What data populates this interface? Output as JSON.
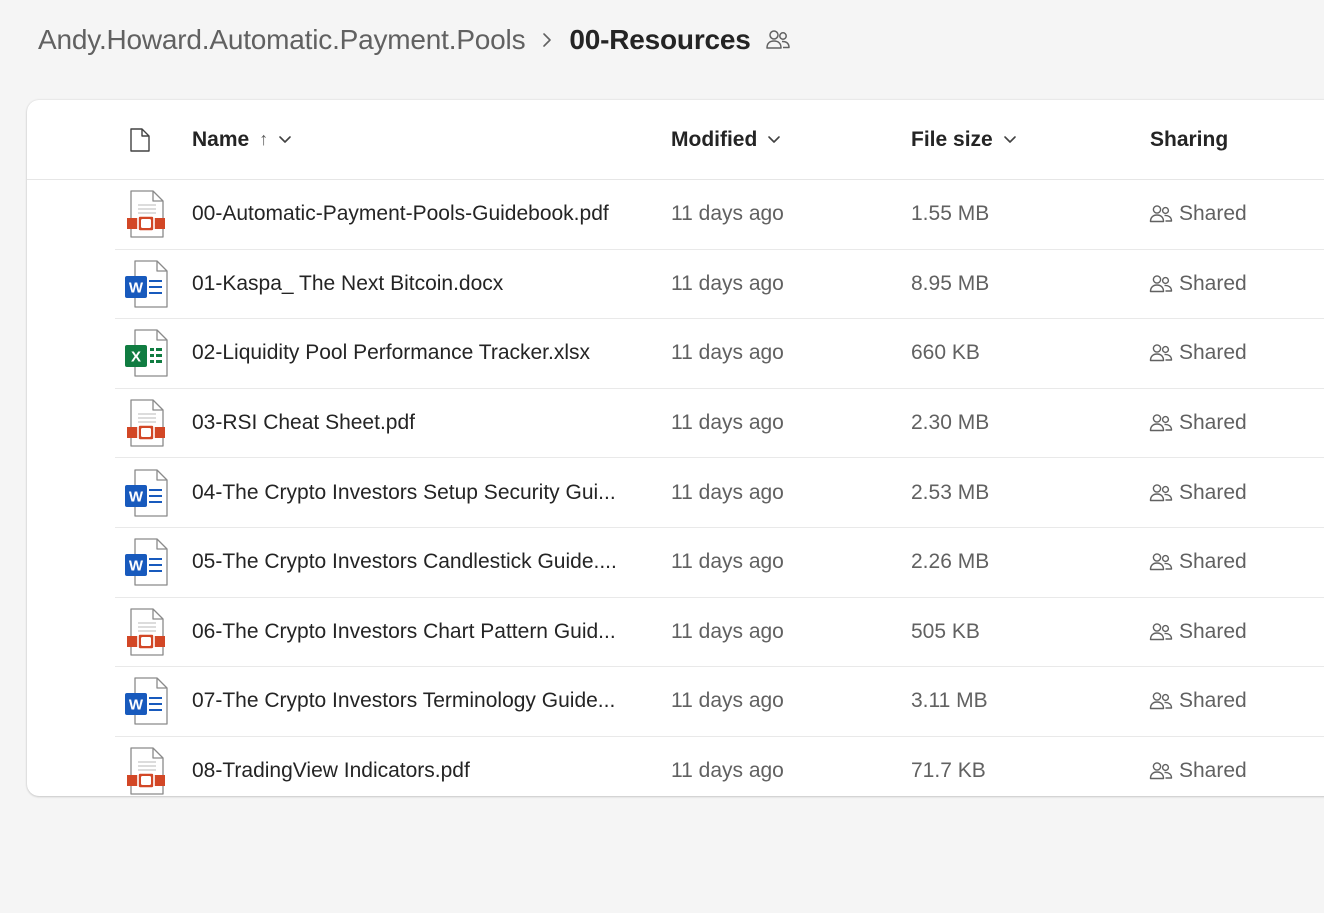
{
  "breadcrumb": {
    "parent": "Andy.Howard.Automatic.Payment.Pools",
    "current": "00-Resources",
    "shared_icon": "people-icon"
  },
  "columns": {
    "type_icon": "file-icon",
    "name": "Name",
    "name_sort": "↑",
    "modified": "Modified",
    "file_size": "File size",
    "sharing": "Sharing"
  },
  "colors": {
    "pdf": "#d24726",
    "word": "#185abd",
    "excel": "#107c41"
  },
  "files": [
    {
      "type": "pdf",
      "name": "00-Automatic-Payment-Pools-Guidebook.pdf",
      "modified": "11 days ago",
      "size": "1.55 MB",
      "sharing": "Shared"
    },
    {
      "type": "docx",
      "name": "01-Kaspa_ The Next Bitcoin.docx",
      "modified": "11 days ago",
      "size": "8.95 MB",
      "sharing": "Shared"
    },
    {
      "type": "xlsx",
      "name": "02-Liquidity Pool Performance Tracker.xlsx",
      "modified": "11 days ago",
      "size": "660 KB",
      "sharing": "Shared"
    },
    {
      "type": "pdf",
      "name": "03-RSI Cheat Sheet.pdf",
      "modified": "11 days ago",
      "size": "2.30 MB",
      "sharing": "Shared"
    },
    {
      "type": "docx",
      "name": "04-The Crypto Investors Setup  Security Gui...",
      "modified": "11 days ago",
      "size": "2.53 MB",
      "sharing": "Shared"
    },
    {
      "type": "docx",
      "name": "05-The Crypto Investors Candlestick Guide....",
      "modified": "11 days ago",
      "size": "2.26 MB",
      "sharing": "Shared"
    },
    {
      "type": "pdf",
      "name": "06-The Crypto Investors Chart Pattern Guid...",
      "modified": "11 days ago",
      "size": "505 KB",
      "sharing": "Shared"
    },
    {
      "type": "docx",
      "name": "07-The Crypto Investors Terminology Guide...",
      "modified": "11 days ago",
      "size": "3.11 MB",
      "sharing": "Shared"
    },
    {
      "type": "pdf",
      "name": "08-TradingView Indicators.pdf",
      "modified": "11 days ago",
      "size": "71.7 KB",
      "sharing": "Shared"
    }
  ]
}
